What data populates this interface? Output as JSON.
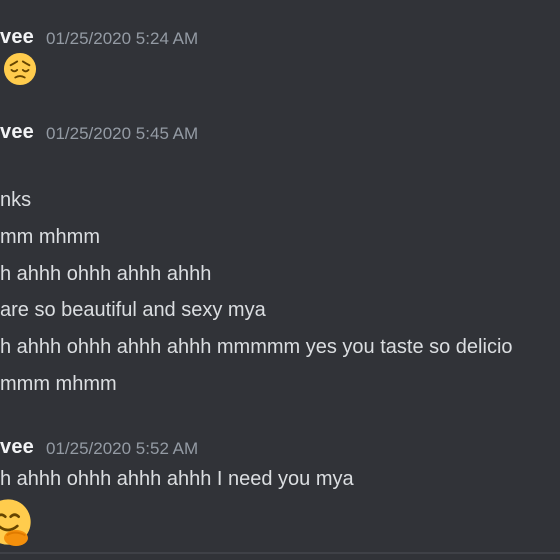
{
  "messages": [
    {
      "author": "vee",
      "timestamp": "01/25/2020 5:24 AM",
      "emoji": "pensive-face-emoji"
    },
    {
      "author": "vee",
      "timestamp": "01/25/2020 5:45 AM",
      "lines": [
        "nks",
        "mm mhmm",
        "h ahhh ohhh ahhh ahhh",
        "are so beautiful and sexy mya",
        "h ahhh ohhh ahhh ahhh mmmmm yes you taste so delicio",
        "mmm mhmm"
      ]
    },
    {
      "author": "vee",
      "timestamp": "01/25/2020 5:52 AM",
      "lines": [
        "h ahhh ohhh ahhh ahhh I need you mya"
      ],
      "emoji": "hugging-face-emoji"
    }
  ],
  "colors": {
    "background": "#313338",
    "author": "#f2f3f5",
    "timestamp": "#949ba4",
    "text": "#dbdee1",
    "emoji": "#ffcc4d"
  }
}
